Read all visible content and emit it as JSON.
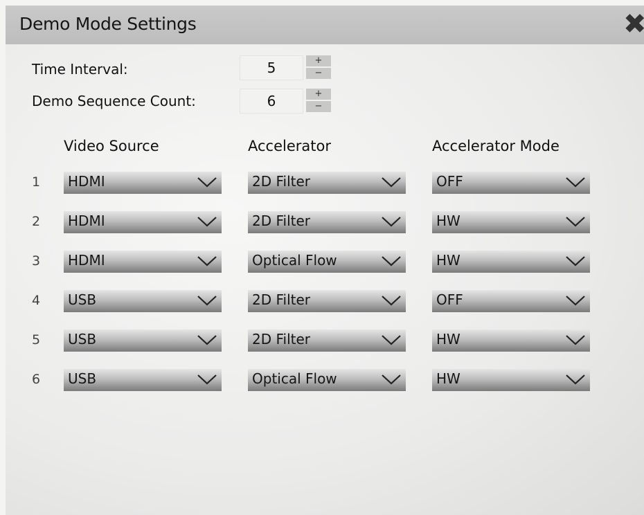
{
  "dialog": {
    "title": "Demo Mode Settings",
    "close_icon": "close-x-icon"
  },
  "settings": {
    "time_interval": {
      "label": "Time Interval:",
      "value": "5",
      "plus": "+",
      "minus": "−"
    },
    "sequence_count": {
      "label": "Demo Sequence Count:",
      "value": "6",
      "plus": "+",
      "minus": "−"
    }
  },
  "columns": {
    "video_source": "Video Source",
    "accelerator": "Accelerator",
    "accelerator_mode": "Accelerator Mode"
  },
  "rows": [
    {
      "index": "1",
      "video_source": "HDMI",
      "accelerator": "2D Filter",
      "mode": "OFF"
    },
    {
      "index": "2",
      "video_source": "HDMI",
      "accelerator": "2D Filter",
      "mode": "HW"
    },
    {
      "index": "3",
      "video_source": "HDMI",
      "accelerator": "Optical Flow",
      "mode": "HW"
    },
    {
      "index": "4",
      "video_source": "USB",
      "accelerator": "2D Filter",
      "mode": "OFF"
    },
    {
      "index": "5",
      "video_source": "USB",
      "accelerator": "2D Filter",
      "mode": "HW"
    },
    {
      "index": "6",
      "video_source": "USB",
      "accelerator": "Optical Flow",
      "mode": "HW"
    }
  ],
  "icons": {
    "dropdown": "chevron-down-icon"
  }
}
